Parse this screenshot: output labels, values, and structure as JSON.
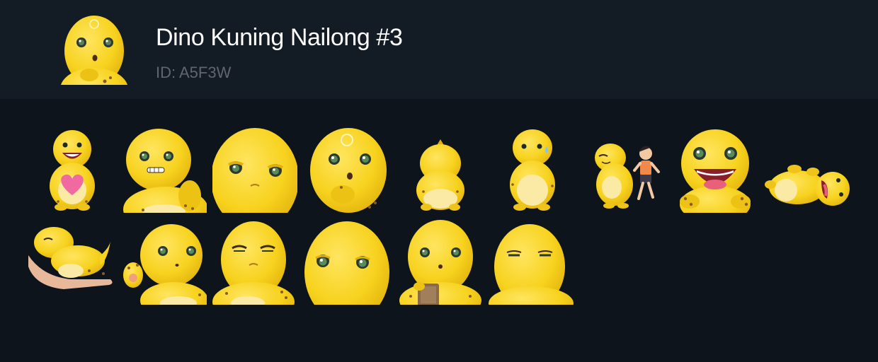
{
  "pack": {
    "title": "Dino Kuning Nailong #3",
    "id_text": "ID: A5F3W"
  },
  "colors": {
    "page_background": "#0d141c",
    "header_background": "#131b24",
    "title_text": "#ffffff",
    "id_text": "#5f666f",
    "dino_yellow": "#f7d21e",
    "dino_belly": "#fbe9a6"
  },
  "stickers": [
    {
      "icon": "dino-holding-heart-icon"
    },
    {
      "icon": "dino-grimacing-icon"
    },
    {
      "icon": "dino-glaring-face-icon"
    },
    {
      "icon": "dino-thinking-icon"
    },
    {
      "icon": "dino-facing-away-icon"
    },
    {
      "icon": "dino-sweating-icon"
    },
    {
      "icon": "dino-with-boy-icon"
    },
    {
      "icon": "dino-open-mouth-icon"
    },
    {
      "icon": "dino-lying-down-icon"
    },
    {
      "icon": "dino-on-hand-icon"
    },
    {
      "icon": "dino-waving-icon"
    },
    {
      "icon": "dino-smug-icon"
    },
    {
      "icon": "dino-staring-face-icon"
    },
    {
      "icon": "dino-holding-phone-icon"
    },
    {
      "icon": "dino-unimpressed-icon"
    }
  ]
}
